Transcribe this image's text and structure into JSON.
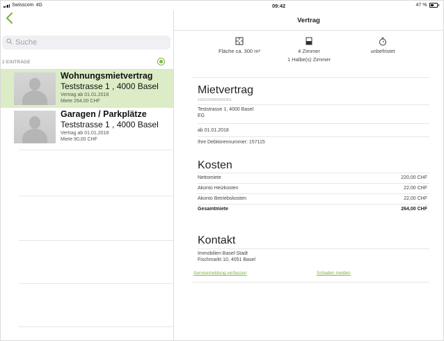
{
  "status_bar": {
    "carrier": "Swisscom",
    "network": "4G",
    "time": "09:42",
    "battery": "47 %"
  },
  "left": {
    "search_placeholder": "Suche",
    "count_label": "2 EINTRÄGE",
    "items": [
      {
        "title": "Wohnungsmietvertrag",
        "address": "Teststrasse 1 , 4000 Basel",
        "line1": "Vertrag ab 01.01.2018",
        "line2": "Miete 264,00 CHF",
        "selected": true
      },
      {
        "title": "Garagen / Parkplätze",
        "address": "Teststrasse 1 , 4000 Basel",
        "line1": "Vertrag ab 01.01.2018",
        "line2": "Miete 90,00 CHF",
        "selected": false
      }
    ]
  },
  "right": {
    "title": "Vertrag",
    "facts": {
      "area": "Fläche ca. 300 m²",
      "rooms": "4 Zimmer",
      "half_rooms": "1 Halbe(s) Zimmer",
      "term": "unbefristet"
    },
    "contract": {
      "heading": "Mietvertrag",
      "number": "4150/1000000001961",
      "address": "Teststrasse 1, 4000 Basel",
      "floor": "EG",
      "start": "ab 01.01.2018",
      "debtor": "Ihre Debitorennummer: 157115"
    },
    "costs": {
      "heading": "Kosten",
      "rows": [
        {
          "label": "Nettomiete",
          "value": "220,00 CHF"
        },
        {
          "label": "Akonto Heizkosten",
          "value": "22,00 CHF"
        },
        {
          "label": "Akonto Betriebskosten",
          "value": "22,00 CHF"
        }
      ],
      "total_label": "Gesamtmiete",
      "total_value": "264,00 CHF"
    },
    "contact": {
      "heading": "Kontakt",
      "line1": "Immobilien Basel-Stadt",
      "line2": "Fischmarkt 10, 4051 Basel",
      "link_service": "Servicemeldung verfassen",
      "link_damage": "Schaden melden"
    }
  },
  "colors": {
    "accent": "#7cb342",
    "selected_bg": "#dcecc6"
  }
}
